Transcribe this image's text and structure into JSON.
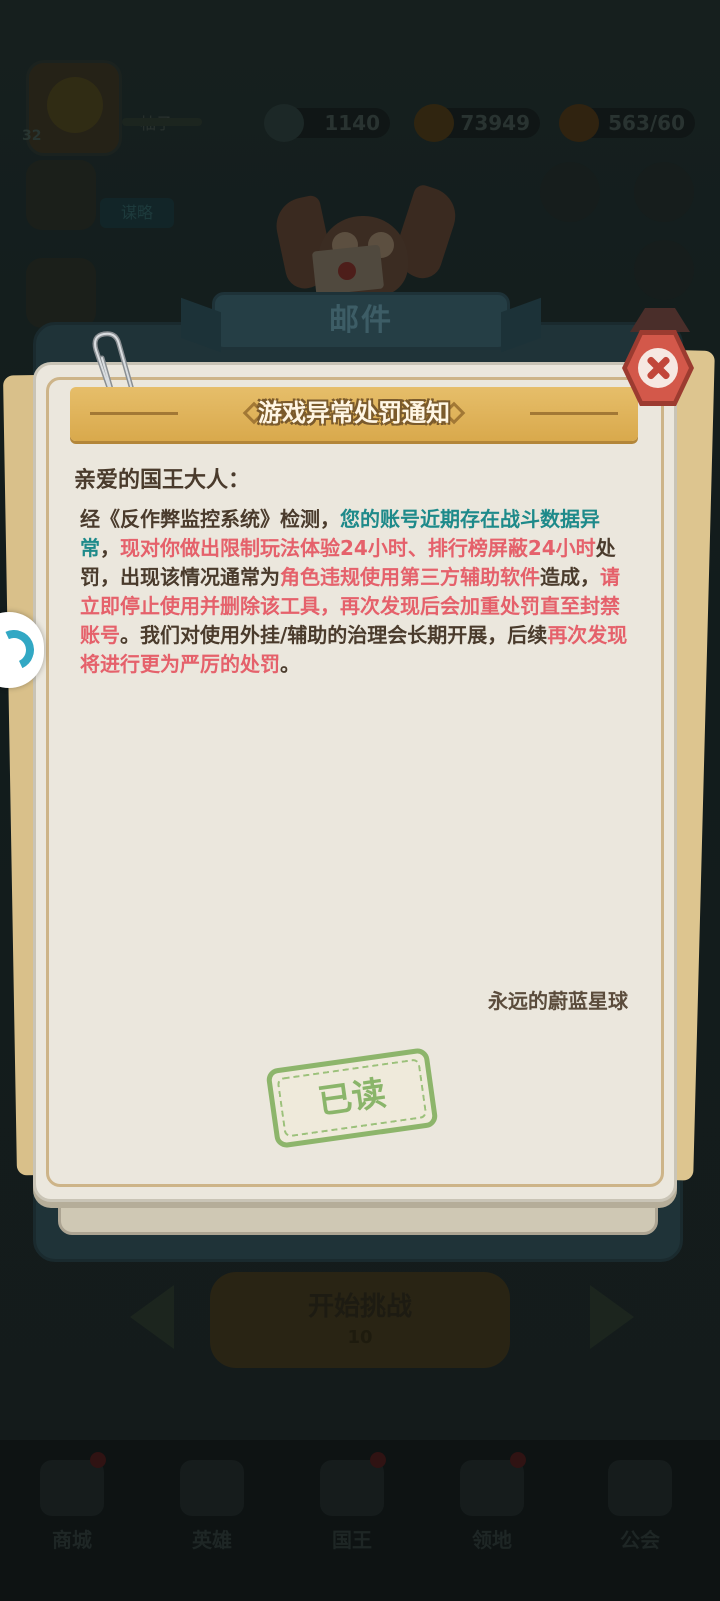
{
  "background": {
    "player_name": "柚子",
    "level": "32",
    "stats": {
      "gems": "1140",
      "gold": "73949",
      "stamina": "563/60"
    },
    "side_button": "谋略",
    "start_button": "开始挑战",
    "start_cost": "10",
    "nav": [
      "商城",
      "英雄",
      "国王",
      "领地",
      "公会"
    ]
  },
  "mail": {
    "tab_title": "邮件",
    "notice_title": "游戏异常处罚通知",
    "greeting": "亲爱的国王大人：",
    "body_segments": [
      {
        "text": "经《反作弊监控系统》检测，",
        "style": "normal"
      },
      {
        "text": "您的账号近期存在战斗数据异常",
        "style": "teal"
      },
      {
        "text": "，",
        "style": "normal"
      },
      {
        "text": "现对你做出限制玩法体验24小时、排行榜屏蔽24小时",
        "style": "red"
      },
      {
        "text": "处罚，出现该情况通常为",
        "style": "normal"
      },
      {
        "text": "角色违规使用第三方辅助软件",
        "style": "red"
      },
      {
        "text": "造成，",
        "style": "normal"
      },
      {
        "text": "请立即停止使用并删除该工具，再次发现后会加重处罚直至封禁账号",
        "style": "red"
      },
      {
        "text": "。我们对使用外挂/辅助的治理会长期开展，后续",
        "style": "normal"
      },
      {
        "text": "再次发现将进行更为严厉的处罚",
        "style": "red"
      },
      {
        "text": "。",
        "style": "normal"
      }
    ],
    "signature": "永远的蔚蓝星球",
    "read_stamp": "已读"
  },
  "colors": {
    "teal_text": "#1e8a8a",
    "red_text": "#e5616b",
    "body_text": "#4a3b2c",
    "stamp_green": "#8ab56a",
    "close_red": "#d3584a"
  },
  "icons": [
    "close-icon",
    "paperclip-icon",
    "owl-mascot-icon",
    "floating-assistant-icon"
  ]
}
